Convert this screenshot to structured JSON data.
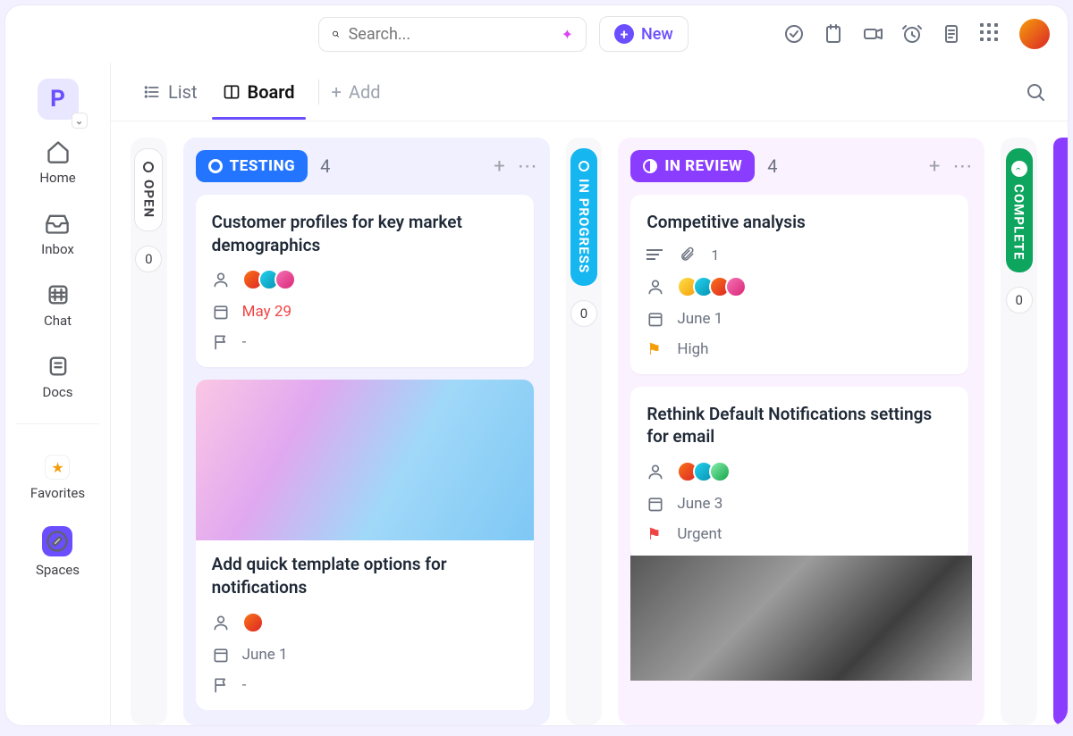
{
  "topbar": {
    "search_placeholder": "Search...",
    "new_label": "New"
  },
  "sidebar": {
    "workspace_letter": "P",
    "items": [
      {
        "label": "Home"
      },
      {
        "label": "Inbox"
      },
      {
        "label": "Chat"
      },
      {
        "label": "Docs"
      },
      {
        "label": "Favorites"
      },
      {
        "label": "Spaces"
      }
    ]
  },
  "viewbar": {
    "list_label": "List",
    "board_label": "Board",
    "add_label": "Add"
  },
  "columns": {
    "open": {
      "name": "OPEN",
      "count": "0"
    },
    "testing": {
      "name": "TESTING",
      "count": "4"
    },
    "in_progress": {
      "name": "IN PROGRESS",
      "count": "0"
    },
    "in_review": {
      "name": "IN REVIEW",
      "count": "4"
    },
    "complete": {
      "name": "COMPLETE",
      "count": "0"
    }
  },
  "cards": {
    "t1": {
      "title": "Customer profiles for key market demographics",
      "date": "May 29",
      "priority": "-"
    },
    "t2": {
      "title": "Add quick template options for notifications",
      "date": "June 1",
      "priority": "-"
    },
    "r1": {
      "title": "Competitive analysis",
      "attachments": "1",
      "date": "June 1",
      "priority": "High"
    },
    "r2": {
      "title": "Rethink Default Notifications settings for email",
      "date": "June 3",
      "priority": "Urgent"
    }
  }
}
